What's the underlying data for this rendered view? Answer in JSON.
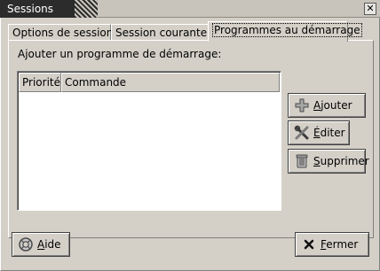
{
  "window": {
    "title": "Sessions",
    "close_glyph": "✕"
  },
  "tabs": [
    {
      "label": "Options de session"
    },
    {
      "label": "Session courante"
    },
    {
      "label": "Programmes au démarrage"
    }
  ],
  "startup": {
    "section_label": "Ajouter un programme de démarrage:",
    "columns": [
      "Priorité",
      "Commande"
    ],
    "buttons": {
      "add": {
        "mnemonic": "A",
        "rest": "jouter",
        "icon": "plus-icon"
      },
      "edit": {
        "mnemonic": "É",
        "rest": "diter",
        "icon": "tools-icon"
      },
      "remove": {
        "mnemonic": "S",
        "rest": "upprimer",
        "icon": "trash-icon"
      }
    }
  },
  "footer": {
    "help": {
      "mnemonic": "A",
      "rest": "ide",
      "icon": "lifebuoy-icon"
    },
    "close": {
      "mnemonic": "F",
      "rest": "ermer",
      "icon": "close-x-icon"
    }
  }
}
